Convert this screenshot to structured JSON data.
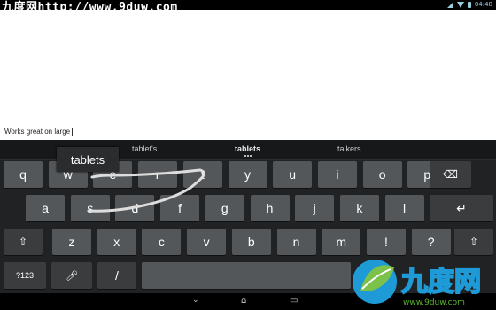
{
  "status_bar": {
    "watermark": "九度网http://www.9duw.com",
    "time": "04:48"
  },
  "editor": {
    "text": "Works great on large"
  },
  "suggestions": [
    "tablet's",
    "tablets",
    "talkers"
  ],
  "gesture_preview": "tablets",
  "keyboard": {
    "row1": [
      "q",
      "w",
      "e",
      "r",
      "t",
      "y",
      "u",
      "i",
      "o",
      "p"
    ],
    "row2": [
      "a",
      "s",
      "d",
      "f",
      "g",
      "h",
      "j",
      "k",
      "l"
    ],
    "row3": [
      "z",
      "x",
      "c",
      "v",
      "b",
      "n",
      "m",
      "!",
      "?"
    ],
    "row4": {
      "symbols_label": "?123",
      "slash": "/"
    }
  },
  "logo": {
    "brand": "九度网",
    "url": "www.9duw.com"
  },
  "icons": [
    "wifi-icon",
    "signal-icon",
    "battery-icon",
    "backspace-icon",
    "enter-icon",
    "shift-icon",
    "mic-icon",
    "back-icon",
    "home-icon",
    "recents-icon"
  ],
  "colors": {
    "keyboard_bg": "#202224",
    "key": "#545759",
    "key_fn": "#3a3c3e",
    "swipe_trail": "#dddddd",
    "logo_green": "#5ab52e",
    "logo_blue": "#1e9ad6"
  }
}
